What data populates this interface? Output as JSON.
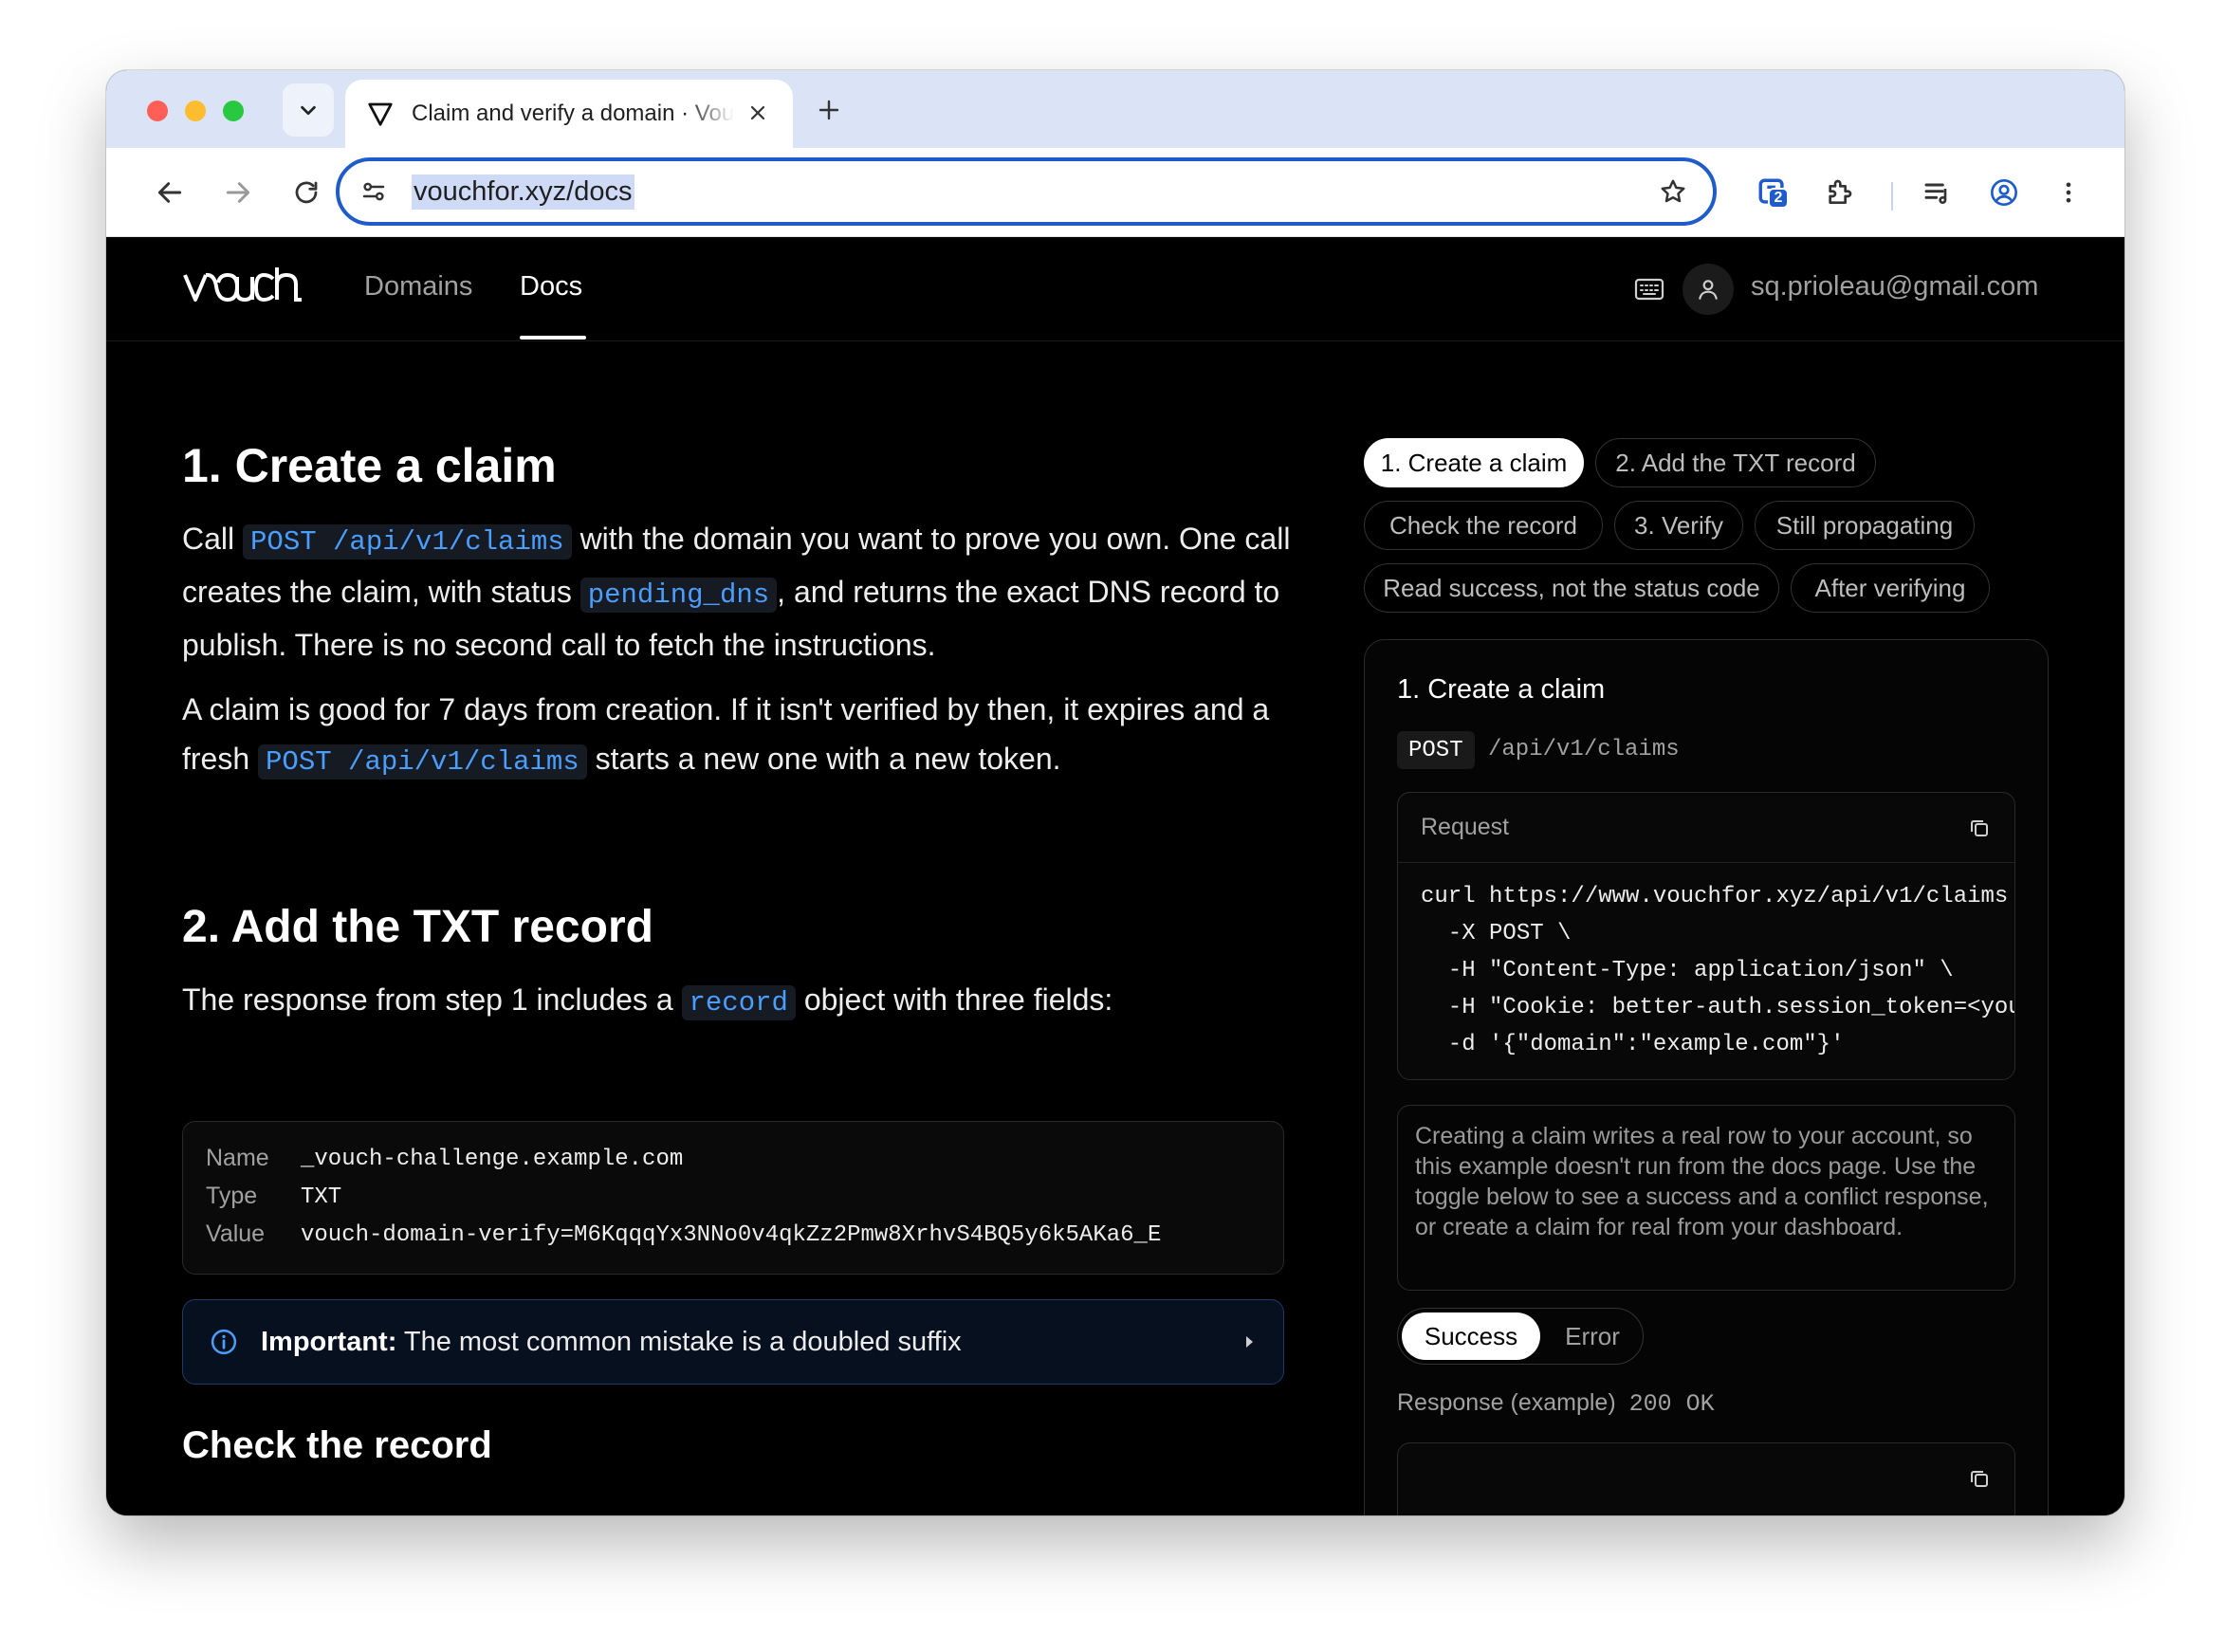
{
  "browser": {
    "tab_title": "Claim and verify a domain · Vouch",
    "url": "vouchfor.xyz/docs",
    "extension_badge_count": "2"
  },
  "nav": {
    "logo_text": "vouch",
    "links": [
      "Domains",
      "Docs"
    ],
    "active_link": "Docs",
    "user_email": "sq.prioleau@gmail.com"
  },
  "main": {
    "section1": {
      "heading": "1. Create a claim",
      "p1": {
        "t1": "Call ",
        "c1": "POST /api/v1/claims",
        "t2": " with the domain you want to prove you own. One call creates the claim, with status ",
        "c2": "pending_dns",
        "t3": ", and returns the exact DNS record to publish. There is no second call to fetch the instructions."
      },
      "p2": {
        "t1": "A claim is good for 7 days from creation. If it isn't verified by then, it expires and a fresh ",
        "c1": "POST /api/v1/claims",
        "t2": " starts a new one with a new token."
      }
    },
    "section2": {
      "heading": "2. Add the TXT record",
      "p1": {
        "t1": "The response from step 1 includes a ",
        "c1": "record",
        "t2": " object with three fields:"
      },
      "record": [
        {
          "label": "Name",
          "value": "_vouch-challenge.example.com"
        },
        {
          "label": "Type",
          "value": "TXT"
        },
        {
          "label": "Value",
          "value": "vouch-domain-verify=M6KqqqYx3NNo0v4qkZz2Pmw8XrhvS4BQ5y6k5AKa6_E"
        }
      ],
      "callout": {
        "bold": "Important:",
        "text": " The most common mistake is a doubled suffix"
      }
    },
    "section3": {
      "heading": "Check the record"
    }
  },
  "sidebar": {
    "chips": [
      "1. Create a claim",
      "2. Add the TXT record",
      "Check the record",
      "3. Verify",
      "Still propagating",
      "Read success, not the status code",
      "After verifying"
    ],
    "active_chip": "1. Create a claim",
    "panel": {
      "title": "1. Create a claim",
      "method": "POST",
      "path": "/api/v1/claims",
      "request_label": "Request",
      "code": [
        "curl https://www.vouchfor.xyz/api/v1/claims",
        "  -X POST \\",
        "  -H \"Content-Type: application/json\" \\",
        "  -H \"Cookie: better-auth.session_token=<your",
        "  -d '{\"domain\":\"example.com\"}'"
      ],
      "note": "Creating a claim writes a real row to your account, so this example doesn't run from the docs page. Use the toggle below to see a success and a conflict response, or create a claim for real from your dashboard.",
      "toggle": [
        "Success",
        "Error"
      ],
      "toggle_selected": "Success",
      "response_label": "Response (example)",
      "response_status": "200 OK"
    }
  },
  "colors": {
    "accent_code": "#4a9eff",
    "omnibox_border": "#1f5cc9",
    "callout_border": "#1d3a68"
  }
}
